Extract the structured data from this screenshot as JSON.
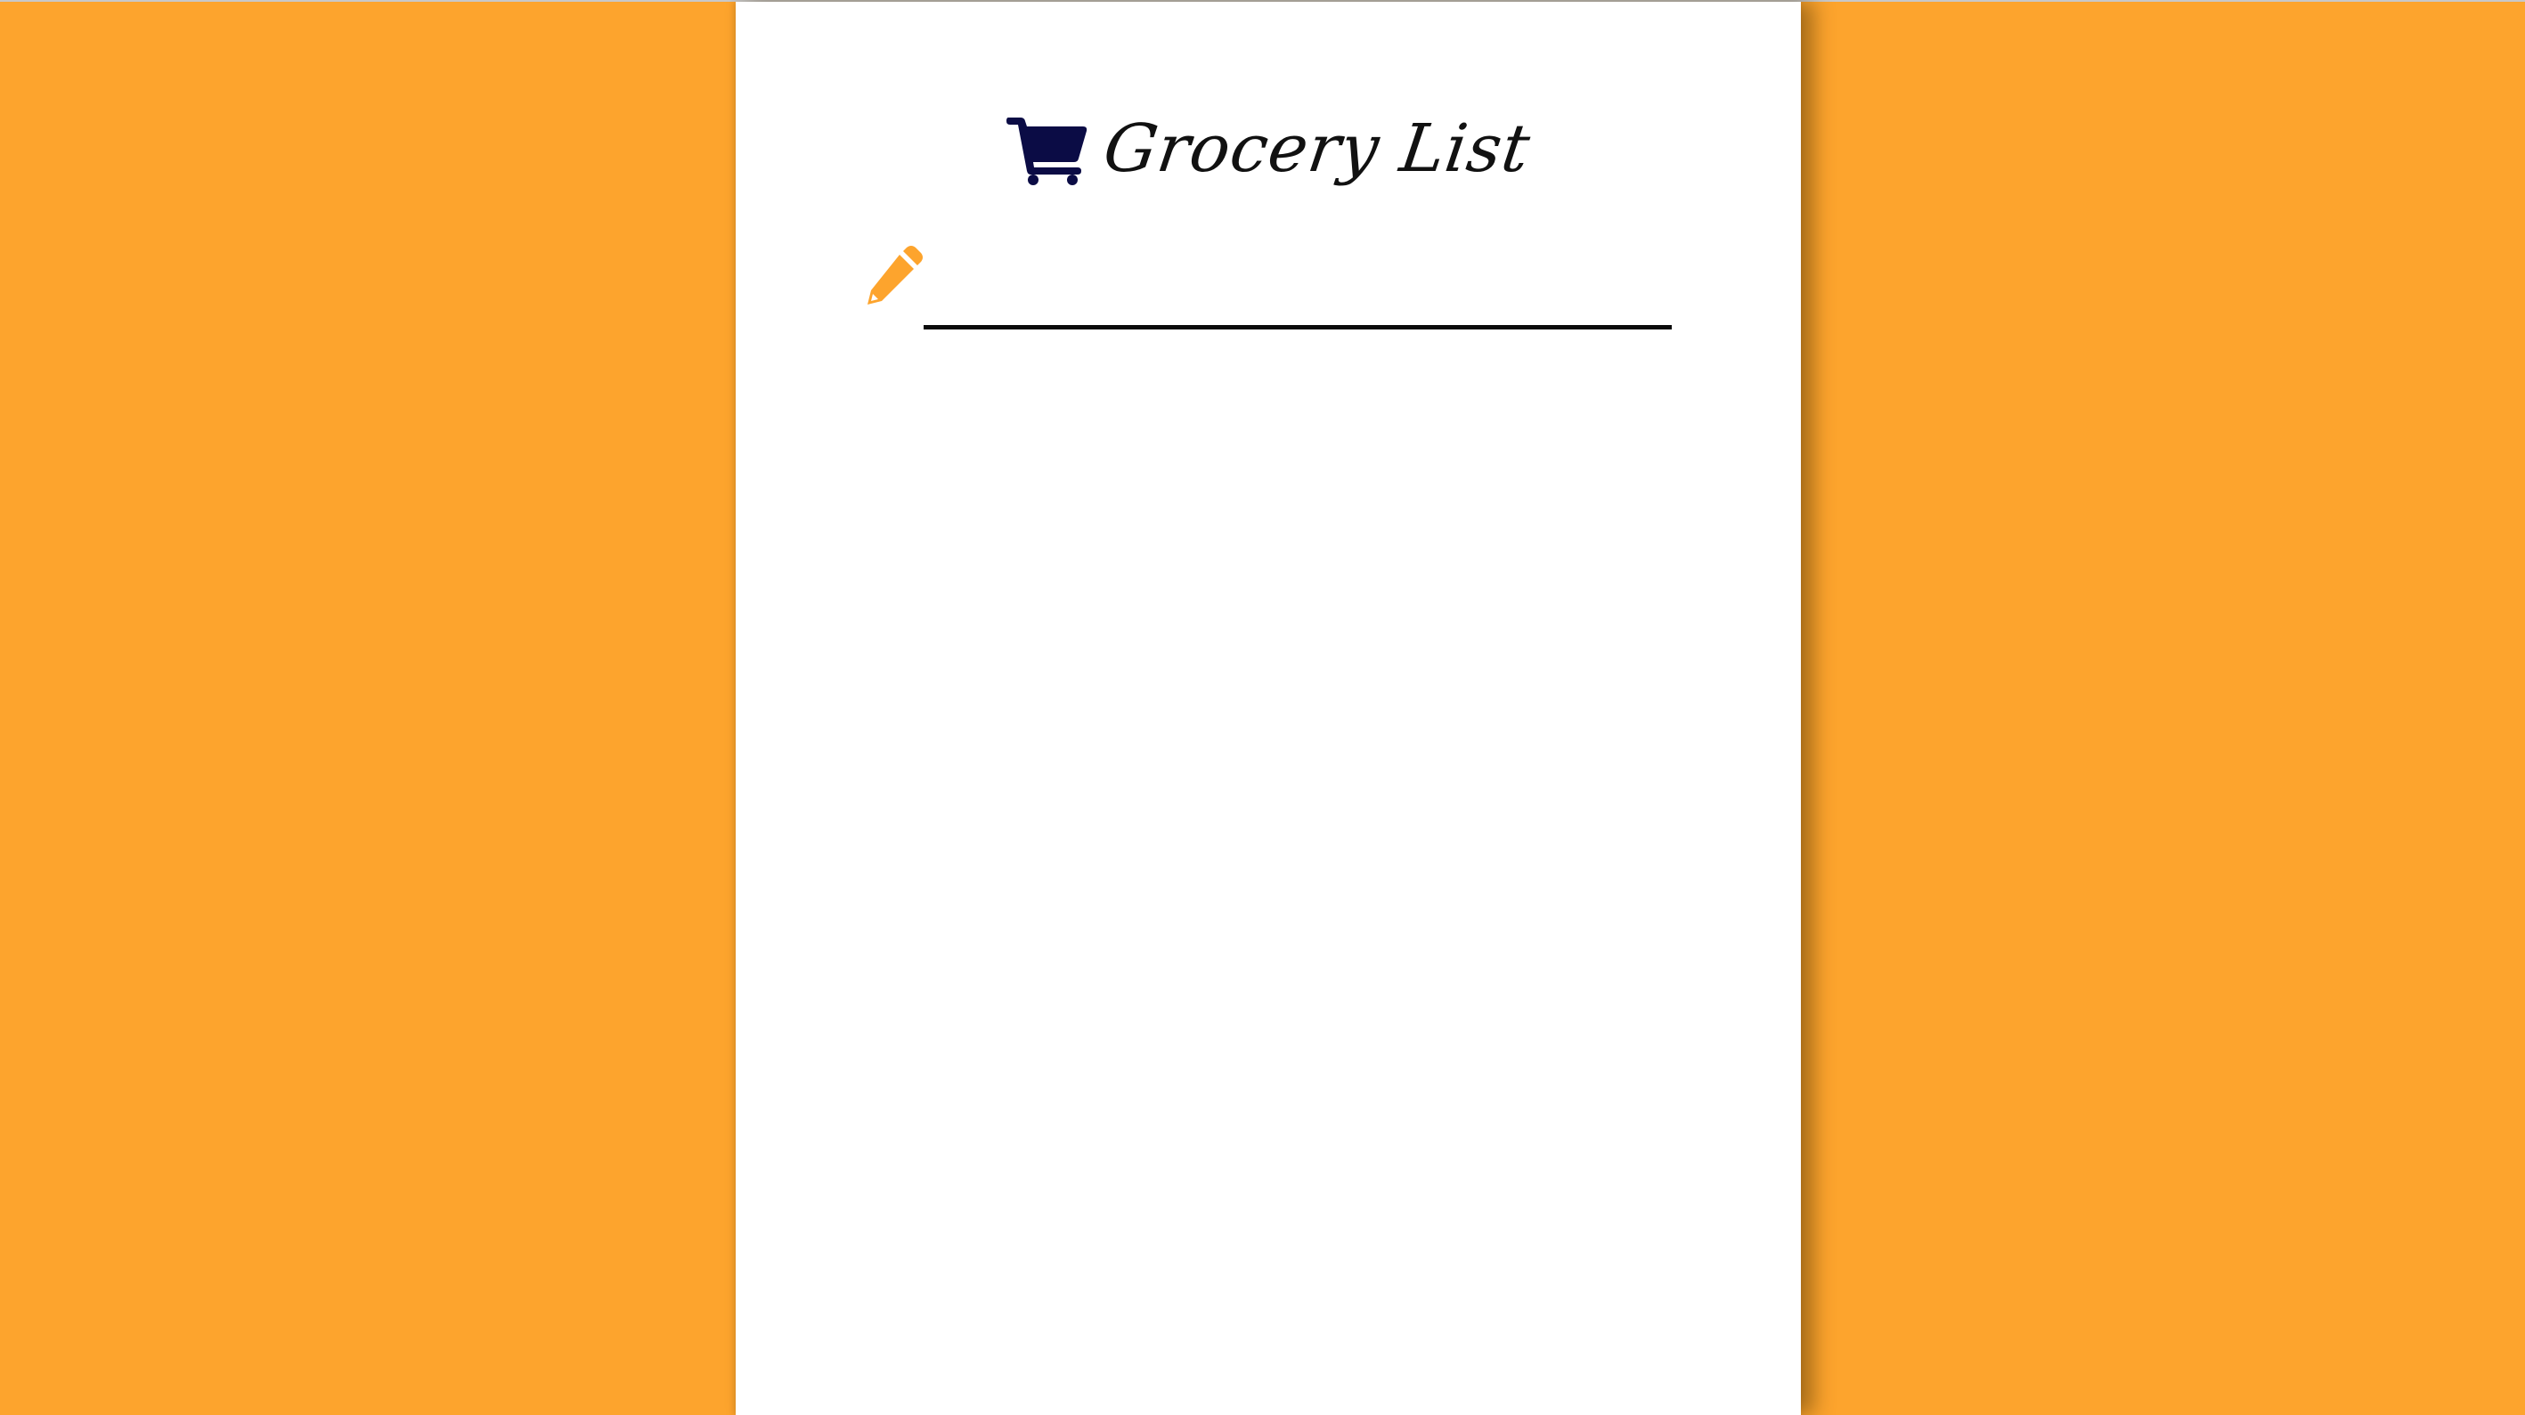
{
  "colors": {
    "background": "#FDA42D",
    "sheet": "#FFFFFF",
    "cart": "#0B0C45",
    "pencil": "#FDA42D",
    "underline": "#0B0B0B"
  },
  "header": {
    "icon": "shopping-cart-icon",
    "title": "Grocery List"
  },
  "new_item": {
    "icon": "pencil-icon",
    "value": "",
    "placeholder": ""
  },
  "items": []
}
